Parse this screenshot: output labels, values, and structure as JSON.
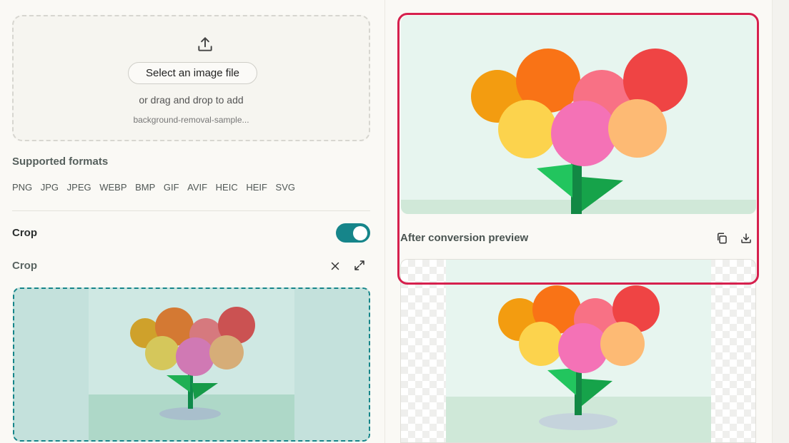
{
  "upload": {
    "icon": "upload-icon",
    "select_button": "Select an image file",
    "drag_text": "or drag and drop to add",
    "file_name": "background-removal-sample..."
  },
  "supported": {
    "title": "Supported formats",
    "formats": [
      "PNG",
      "JPG",
      "JPEG",
      "WEBP",
      "BMP",
      "GIF",
      "AVIF",
      "HEIC",
      "HEIF",
      "SVG"
    ]
  },
  "crop": {
    "toggle_label": "Crop",
    "toggle_on": true,
    "section_title": "Crop",
    "close_icon": "close-icon",
    "expand_icon": "expand-icon"
  },
  "preview": {
    "title": "After conversion preview",
    "copy_icon": "copy-icon",
    "download_icon": "download-icon"
  },
  "colors": {
    "accent": "#16858a",
    "highlight": "#d6204d"
  }
}
